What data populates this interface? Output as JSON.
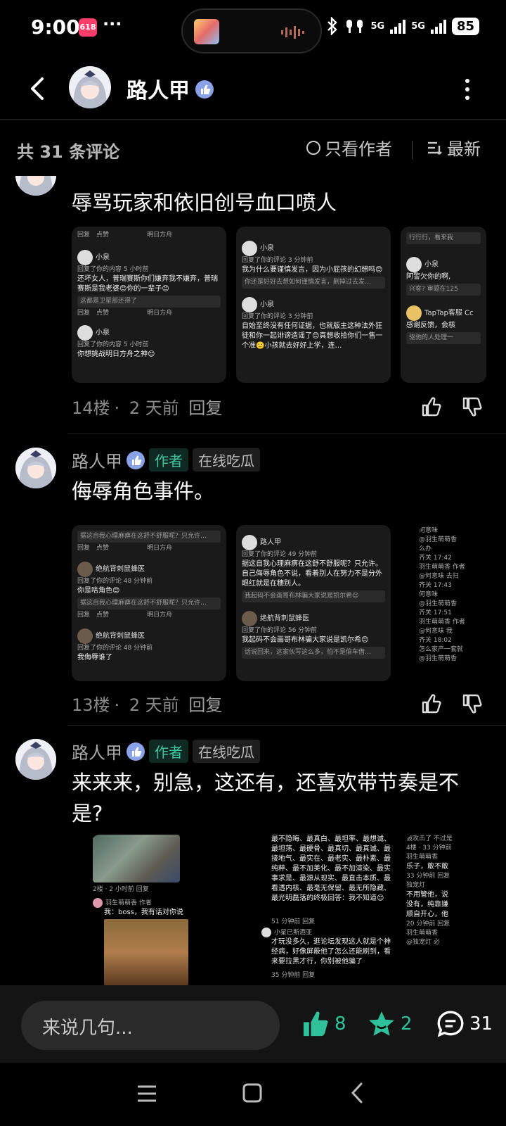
{
  "status_bar": {
    "time": "9:00",
    "badge": "618",
    "dots": "···",
    "net1": "5G",
    "net2": "5G",
    "battery": "85"
  },
  "header": {
    "name": "路人甲"
  },
  "sort": {
    "count": "共 31 条评论",
    "only_author": "只看作者",
    "latest": "最新"
  },
  "comments": [
    {
      "text": "辱骂玩家和依旧创号血口喷人",
      "floor": "14楼",
      "time": "2 天前",
      "reply": "回复",
      "shots": {
        "a_reply": "回复",
        "a_like": "点赞",
        "a_src": "明日方舟",
        "a_user1": "小泉",
        "a_sub1": "回复了你的内容 5 小时前",
        "a_text1": "还坏女人，普瑞赛斯你们嫌弃我不嫌弃，普瑞赛斯是我老婆😊你的一辈子😊",
        "a_quote1": "这都是卫星部还得了",
        "a_user2": "小泉",
        "a_sub2": "回复了你的内容 5 小时前",
        "a_text2": "你想挑战明日方舟之神😊",
        "b_user1": "小泉",
        "b_sub1": "回复了你的评论 3 分钟前",
        "b_text1": "我为什么要谨慎发言，因为小屁孩的幻想吗😊",
        "b_quote1": "你还是好好去想如何谨慎发言，删掉过去发…",
        "b_user2": "小泉",
        "b_sub2": "回复了你的评论 3 分钟前",
        "b_text2": "自始至终没有任何证据，也就版主这种法外狂徒和你一起诽谤造谣了😊真想收拾你们一售一个准🙂小孩就去好好上学，连…",
        "c_text1": "行行行，看来我",
        "c_user1": "小泉",
        "c_text2": "阿警欠你的啊,",
        "c_quote": "兴客? 审题在125",
        "c_user2": "TapTap客服 Cc",
        "c_text3": "感谢反馈，会核",
        "c_quote2": "驱驰的人处理一"
      }
    },
    {
      "name": "路人甲",
      "tag_author": "作者",
      "tag_mood": "在线吃瓜",
      "text": "侮辱角色事件。",
      "floor": "13楼",
      "time": "2 天前",
      "reply": "回复",
      "shots": {
        "a_quote0": "据这自我心理麻痹在这舒不舒服呢？只允许…",
        "a_reply": "回复",
        "a_like": "点赞",
        "a_src": "明日方舟",
        "a_user1": "绝航背刺鼠蜂医",
        "a_sub1": "回复了你的评论 48 分钟前",
        "a_text1": "你是啥角色😊",
        "a_quote1": "据这自我心理麻痹在这舒不舒服呢？只允许…",
        "a_user2": "绝航背刺鼠蜂医",
        "a_sub2": "回复了你的评论 48 分钟前",
        "a_text2": "我侮辱谁了",
        "b_user1": "路人甲",
        "b_sub1": "回复了你的评论 49 分钟前",
        "b_text1": "据这自我心理麻痹在这舒不舒服呢？只允许。自己侮辱角色不说，看着别人在努力不是分外眼红就是在穗别人。",
        "b_quote1": "我起码不会画哥布林骗大家说是凯尔希😊",
        "b_user2": "绝航背刺鼠蜂医",
        "b_sub2": "回复了你的评论 56 分钟前",
        "b_text2": "我起码不会画哥布林骗大家说是凯尔希😊",
        "b_quote2": "话说回来，这家伙写这么多，怕不是偷车借…",
        "c_lines": [
          "何意味",
          "@羽生萌萌香",
          "么办",
          "齐关 17:42",
          "羽生萌萌香 作者",
          "@何意味 去扫",
          "齐关 17:43",
          "何意味",
          "@羽生萌萌香",
          "齐关 17:51",
          "羽生萌萌香 作者",
          "@何意味 我",
          "齐关 18:02",
          "怎么家产一套就",
          "@羽生萌萌香"
        ]
      }
    },
    {
      "name": "路人甲",
      "tag_author": "作者",
      "tag_mood": "在线吃瓜",
      "text": "来来来，别急，这还有，还喜欢带节奏是不是?",
      "shots": {
        "a_meta": "2楼 · 2 小时前   回复",
        "a_user": "羽生萌萌香 作者",
        "a_text": "我：boss，我有话对你说",
        "b_text": "最不隐晦、最真白、最坦率、最想诚、最坦荡、最硬骨、最真切、最真诚、最接地气、最实在、最老实、最朴素、最纯粹、最不加美化、最不加渲染、最实事求是、最源从现实、最直击本质、最看透内核、最毫无保留、最无所隐藏、最光明磊落的终极回答：我不知道😊",
        "b_meta1": "51 分钟前  回复",
        "b_user": "小星已斯酒亚",
        "b_text2": "才玩没多久，逛论坛发现这人就是个神经病，好像屏蔽他了怎么还能刷到，看来要拉黑才行，你别被他骗了",
        "b_meta2": "35 分钟前  回复",
        "c_lines": [
          "被攻击了 不过是",
          "4楼 · 33 分钟前",
          "羽生萌萌香",
          "乐子，敢不敢",
          "33 分钟前 回复",
          "独宠灯",
          "不用管他，说",
          "没有，纯靠嫌",
          "顺自开心，他",
          "20 分钟前 回复",
          "羽生萌萌香",
          "@独宠灯 必"
        ]
      }
    }
  ],
  "bottom": {
    "placeholder": "来说几句...",
    "likes": "8",
    "favs": "2",
    "comments": "31"
  },
  "colors": {
    "accent_green": "#2fc29a",
    "tag_author_bg": "#0f2a22",
    "verified": "#8aa2e8"
  }
}
